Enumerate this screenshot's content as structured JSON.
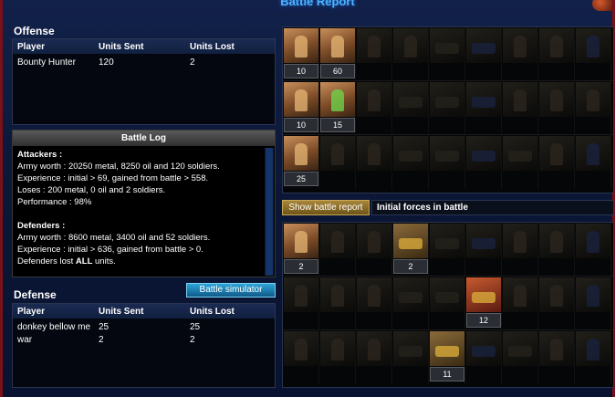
{
  "title": "Battle Report",
  "offense": {
    "heading": "Offense",
    "columns": [
      "Player",
      "Units Sent",
      "Units Lost"
    ],
    "rows": [
      {
        "player": "Bounty Hunter",
        "sent": "120",
        "lost": "2"
      }
    ]
  },
  "battle_log": {
    "heading": "Battle Log",
    "attackers_label": "Attackers :",
    "attackers_lines": [
      "Army worth : 20250 metal, 8250 oil and 120 soldiers.",
      "Experience : initial > 69, gained from battle > 558.",
      "Loses : 200 metal, 0 oil and 2 soldiers.",
      "Performance : 98%"
    ],
    "defenders_label": "Defenders :",
    "defenders_lines": [
      "Army worth : 8600 metal, 3400 oil and 52 soldiers.",
      "Experience : initial > 636, gained from battle > 0."
    ],
    "defenders_lost_prefix": "Defenders lost ",
    "defenders_lost_bold": "ALL",
    "defenders_lost_suffix": " units."
  },
  "battle_simulator_label": "Battle simulator",
  "defense": {
    "heading": "Defense",
    "columns": [
      "Player",
      "Units Sent",
      "Units Lost"
    ],
    "rows": [
      {
        "player": "donkey bellow me",
        "sent": "25",
        "lost": "25"
      },
      {
        "player": "war",
        "sent": "2",
        "lost": "2"
      }
    ]
  },
  "show_report_label": "Show battle report",
  "forces_label": "Initial forces in battle",
  "attack_units": {
    "row1": [
      "10",
      "60"
    ],
    "row2": [
      "10",
      "15"
    ],
    "row3": [
      "25"
    ]
  },
  "defense_units": {
    "row1": [
      "2",
      "2"
    ],
    "row2": [
      "12"
    ],
    "row3": [
      "11"
    ]
  }
}
